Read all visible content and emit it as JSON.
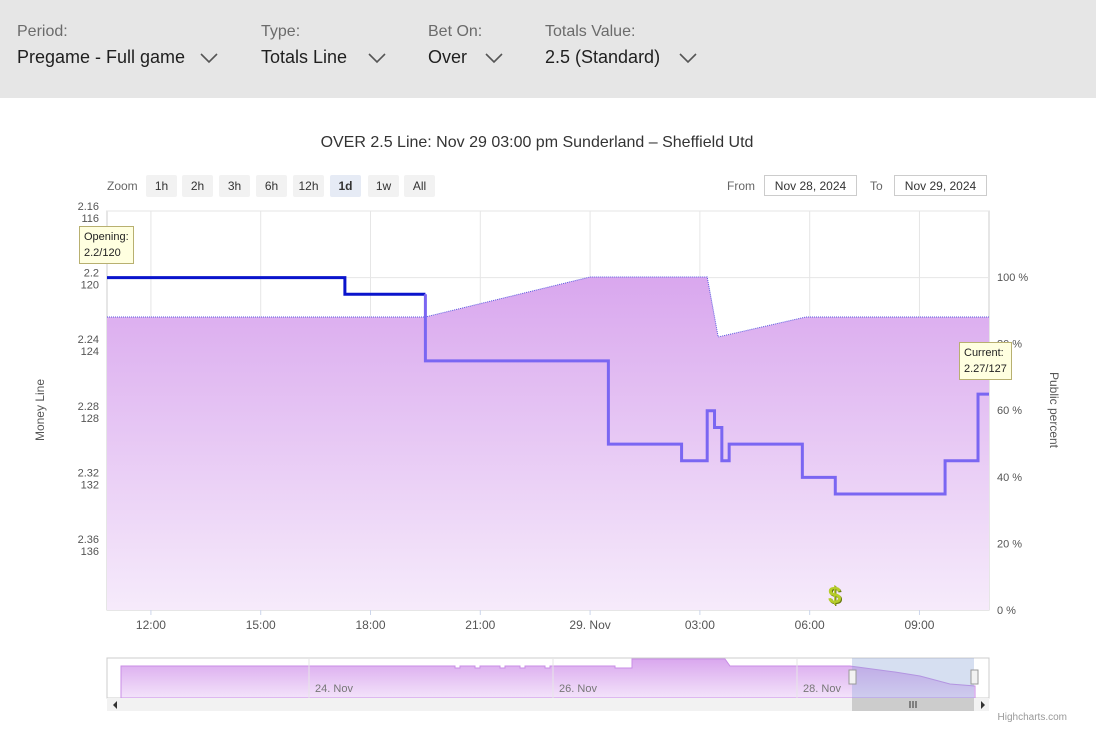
{
  "filters": [
    {
      "label": "Period:",
      "value": "Pregame - Full game"
    },
    {
      "label": "Type:",
      "value": "Totals Line"
    },
    {
      "label": "Bet On:",
      "value": "Over"
    },
    {
      "label": "Totals Value:",
      "value": "2.5 (Standard)"
    }
  ],
  "zoom": {
    "label": "Zoom",
    "buttons": [
      "1h",
      "2h",
      "3h",
      "6h",
      "12h",
      "1d",
      "1w",
      "All"
    ],
    "active": "1d"
  },
  "range": {
    "from_label": "From",
    "from_value": "Nov 28, 2024",
    "to_label": "To",
    "to_value": "Nov 29, 2024"
  },
  "credit": "Highcharts.com",
  "colors": {
    "line_dark": "#0a14cc",
    "line_light": "#7a66f2",
    "area": "#d9a7ee",
    "tooltip_bg": "#ffffe0"
  },
  "icons": {
    "bet_marker": "dollar-icon",
    "dropdown": "chevron-down-icon"
  },
  "chart_data": {
    "type": "line",
    "title": "OVER 2.5 Line: Nov 29 03:00 pm Sunderland – Sheffield Utd",
    "xlabel": "",
    "ylabel_left": "Money Line",
    "ylabel_right": "Public percent",
    "x_ticks": [
      "12:00",
      "15:00",
      "18:00",
      "21:00",
      "29. Nov",
      "03:00",
      "06:00",
      "09:00"
    ],
    "y_left_ticks": [
      {
        "line": "2.16",
        "money": "116"
      },
      {
        "line": "2.2",
        "money": "120"
      },
      {
        "line": "2.24",
        "money": "124"
      },
      {
        "line": "2.28",
        "money": "128"
      },
      {
        "line": "2.32",
        "money": "132"
      },
      {
        "line": "2.36",
        "money": "136"
      }
    ],
    "y_right_ticks": [
      "100 %",
      "80 %",
      "60 %",
      "40 %",
      "20 %",
      "0 %"
    ],
    "ylim_left": [
      2.16,
      2.36
    ],
    "ylim_right": [
      0,
      100
    ],
    "x_range_hours": [
      10.8,
      34.9
    ],
    "series": [
      {
        "name": "Money Line",
        "x": [
          10.8,
          17.3,
          17.3,
          19.5,
          19.5,
          24.5,
          24.5,
          26.5,
          26.5,
          27.2,
          27.2,
          27.4,
          27.4,
          27.6,
          27.6,
          27.8,
          27.8,
          29.8,
          29.8,
          30.7,
          30.7,
          33.7,
          33.7,
          34.6,
          34.6,
          34.9
        ],
        "y": [
          2.2,
          2.2,
          2.21,
          2.21,
          2.25,
          2.25,
          2.3,
          2.3,
          2.31,
          2.31,
          2.28,
          2.28,
          2.29,
          2.29,
          2.31,
          2.31,
          2.3,
          2.3,
          2.32,
          2.32,
          2.33,
          2.33,
          2.31,
          2.31,
          2.27,
          2.27
        ]
      },
      {
        "name": "Public percent",
        "x": [
          10.8,
          19.5,
          24.0,
          27.2,
          27.5,
          29.9,
          34.9
        ],
        "y": [
          88,
          88,
          100,
          100,
          82,
          88,
          88
        ]
      }
    ],
    "annotations": [
      {
        "label": "Opening:",
        "value": "2.2/120"
      },
      {
        "label": "Current:",
        "value": "2.27/127"
      }
    ],
    "navigator": {
      "x_ticks": [
        "24. Nov",
        "26. Nov",
        "28. Nov"
      ]
    }
  }
}
